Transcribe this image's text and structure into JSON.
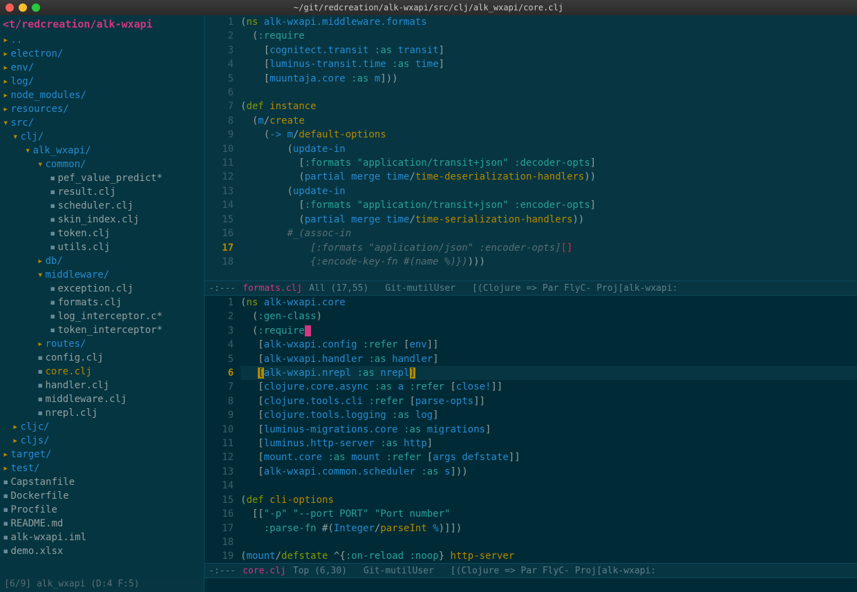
{
  "title": "~/git/redcreation/alk-wxapi/src/clj/alk_wxapi/core.clj",
  "sidebar": {
    "header": "<t/redcreation/alk-wxapi",
    "modeline": "[6/9] alk_wxapi (D:4 F:5)",
    "tree": [
      {
        "type": "folder",
        "name": "..",
        "indent": 0
      },
      {
        "type": "folder",
        "name": "electron/",
        "indent": 0
      },
      {
        "type": "folder",
        "name": "env/",
        "indent": 0
      },
      {
        "type": "folder",
        "name": "log/",
        "indent": 0
      },
      {
        "type": "folder",
        "name": "node_modules/",
        "indent": 0
      },
      {
        "type": "folder",
        "name": "resources/",
        "indent": 0
      },
      {
        "type": "folder",
        "name": "src/",
        "indent": 0,
        "open": true
      },
      {
        "type": "folder",
        "name": "clj/",
        "indent": 1,
        "open": true
      },
      {
        "type": "folder",
        "name": "alk_wxapi/",
        "indent": 2,
        "open": true
      },
      {
        "type": "folder",
        "name": "common/",
        "indent": 3,
        "open": true
      },
      {
        "type": "file",
        "name": "pef_value_predict*",
        "indent": 4
      },
      {
        "type": "file",
        "name": "result.clj",
        "indent": 4
      },
      {
        "type": "file",
        "name": "scheduler.clj",
        "indent": 4
      },
      {
        "type": "file",
        "name": "skin_index.clj",
        "indent": 4
      },
      {
        "type": "file",
        "name": "token.clj",
        "indent": 4
      },
      {
        "type": "file",
        "name": "utils.clj",
        "indent": 4
      },
      {
        "type": "folder",
        "name": "db/",
        "indent": 3
      },
      {
        "type": "folder",
        "name": "middleware/",
        "indent": 3,
        "open": true
      },
      {
        "type": "file",
        "name": "exception.clj",
        "indent": 4
      },
      {
        "type": "file",
        "name": "formats.clj",
        "indent": 4
      },
      {
        "type": "file",
        "name": "log_interceptor.c*",
        "indent": 4
      },
      {
        "type": "file",
        "name": "token_interceptor*",
        "indent": 4
      },
      {
        "type": "folder",
        "name": "routes/",
        "indent": 3
      },
      {
        "type": "file",
        "name": "config.clj",
        "indent": 3
      },
      {
        "type": "file",
        "name": "core.clj",
        "indent": 3,
        "selected": true
      },
      {
        "type": "file",
        "name": "handler.clj",
        "indent": 3
      },
      {
        "type": "file",
        "name": "middleware.clj",
        "indent": 3
      },
      {
        "type": "file",
        "name": "nrepl.clj",
        "indent": 3
      },
      {
        "type": "folder",
        "name": "cljc/",
        "indent": 1
      },
      {
        "type": "folder",
        "name": "cljs/",
        "indent": 1
      },
      {
        "type": "folder",
        "name": "target/",
        "indent": 0
      },
      {
        "type": "folder",
        "name": "test/",
        "indent": 0
      },
      {
        "type": "file",
        "name": "Capstanfile",
        "indent": 0
      },
      {
        "type": "file",
        "name": "Dockerfile",
        "indent": 0
      },
      {
        "type": "file",
        "name": "Procfile",
        "indent": 0
      },
      {
        "type": "file",
        "name": "README.md",
        "indent": 0
      },
      {
        "type": "file",
        "name": "alk-wxapi.iml",
        "indent": 0
      },
      {
        "type": "file",
        "name": "demo.xlsx",
        "indent": 0
      }
    ]
  },
  "topPane": {
    "modeline": {
      "prefix": "-:---",
      "filename": "formats.clj",
      "pos": "All (17,55)",
      "vcs": "Git-mutilUser",
      "modes": "[(Clojure => Par FlyC- Proj[alk-wxapi:"
    },
    "lines": [
      {
        "n": 1,
        "segs": [
          [
            "p",
            "("
          ],
          [
            "kw",
            "ns"
          ],
          [
            "p",
            " "
          ],
          [
            "sym",
            "alk-wxapi.middleware.formats"
          ]
        ]
      },
      {
        "n": 2,
        "segs": [
          [
            "p",
            "  ("
          ],
          [
            "key",
            ":require"
          ]
        ]
      },
      {
        "n": 3,
        "segs": [
          [
            "p",
            "    ["
          ],
          [
            "sym",
            "cognitect.transit"
          ],
          [
            "p",
            " "
          ],
          [
            "key",
            ":as"
          ],
          [
            "p",
            " "
          ],
          [
            "sym",
            "transit"
          ],
          [
            "p",
            "]"
          ]
        ]
      },
      {
        "n": 4,
        "segs": [
          [
            "p",
            "    ["
          ],
          [
            "sym",
            "luminus-transit.time"
          ],
          [
            "p",
            " "
          ],
          [
            "key",
            ":as"
          ],
          [
            "p",
            " "
          ],
          [
            "sym",
            "time"
          ],
          [
            "p",
            "]"
          ]
        ]
      },
      {
        "n": 5,
        "segs": [
          [
            "p",
            "    ["
          ],
          [
            "sym",
            "muuntaja.core"
          ],
          [
            "p",
            " "
          ],
          [
            "key",
            ":as"
          ],
          [
            "p",
            " "
          ],
          [
            "sym",
            "m"
          ],
          [
            "p",
            "]))"
          ]
        ]
      },
      {
        "n": 6,
        "segs": [
          [
            "p",
            ""
          ]
        ]
      },
      {
        "n": 7,
        "segs": [
          [
            "p",
            "("
          ],
          [
            "kw",
            "def"
          ],
          [
            "p",
            " "
          ],
          [
            "yellow",
            "instance"
          ]
        ]
      },
      {
        "n": 8,
        "segs": [
          [
            "p",
            "  ("
          ],
          [
            "sym",
            "m"
          ],
          [
            "p",
            "/"
          ],
          [
            "fnref",
            "create"
          ]
        ]
      },
      {
        "n": 9,
        "segs": [
          [
            "p",
            "    ("
          ],
          [
            "sym",
            "->"
          ],
          [
            "p",
            " "
          ],
          [
            "sym",
            "m"
          ],
          [
            "p",
            "/"
          ],
          [
            "fnref",
            "default-options"
          ]
        ]
      },
      {
        "n": 10,
        "segs": [
          [
            "p",
            "        ("
          ],
          [
            "sym",
            "update-in"
          ]
        ]
      },
      {
        "n": 11,
        "segs": [
          [
            "p",
            "          ["
          ],
          [
            "key",
            ":formats"
          ],
          [
            "p",
            " "
          ],
          [
            "str",
            "\"application/transit+json\""
          ],
          [
            "p",
            " "
          ],
          [
            "key",
            ":decoder-opts"
          ],
          [
            "p",
            "]"
          ]
        ]
      },
      {
        "n": 12,
        "segs": [
          [
            "p",
            "          ("
          ],
          [
            "sym",
            "partial"
          ],
          [
            "p",
            " "
          ],
          [
            "sym",
            "merge"
          ],
          [
            "p",
            " "
          ],
          [
            "sym",
            "time"
          ],
          [
            "p",
            "/"
          ],
          [
            "fnref",
            "time-deserialization-handlers"
          ],
          [
            "p",
            "))"
          ]
        ]
      },
      {
        "n": 13,
        "segs": [
          [
            "p",
            "        ("
          ],
          [
            "sym",
            "update-in"
          ]
        ]
      },
      {
        "n": 14,
        "segs": [
          [
            "p",
            "          ["
          ],
          [
            "key",
            ":formats"
          ],
          [
            "p",
            " "
          ],
          [
            "str",
            "\"application/transit+json\""
          ],
          [
            "p",
            " "
          ],
          [
            "key",
            ":encoder-opts"
          ],
          [
            "p",
            "]"
          ]
        ]
      },
      {
        "n": 15,
        "segs": [
          [
            "p",
            "          ("
          ],
          [
            "sym",
            "partial"
          ],
          [
            "p",
            " "
          ],
          [
            "sym",
            "merge"
          ],
          [
            "p",
            " "
          ],
          [
            "sym",
            "time"
          ],
          [
            "p",
            "/"
          ],
          [
            "fnref",
            "time-serialization-handlers"
          ],
          [
            "p",
            "))"
          ]
        ]
      },
      {
        "n": 16,
        "segs": [
          [
            "p",
            "        "
          ],
          [
            "ital",
            "#_(assoc-in"
          ]
        ]
      },
      {
        "n": 17,
        "current": true,
        "segs": [
          [
            "p",
            "            "
          ],
          [
            "ital",
            "[:formats \"application/json\" :encoder-opts]"
          ],
          [
            "cursor-red-box",
            "[]"
          ]
        ]
      },
      {
        "n": 18,
        "segs": [
          [
            "p",
            "            "
          ],
          [
            "ital",
            "{:encode-key-fn #(name %)})"
          ],
          [
            "p",
            ")))"
          ]
        ]
      }
    ]
  },
  "bottomPane": {
    "modeline": {
      "prefix": "-:---",
      "filename": "core.clj",
      "pos": "Top (6,30)",
      "vcs": "Git-mutilUser",
      "modes": "[(Clojure => Par FlyC- Proj[alk-wxapi:"
    },
    "lines": [
      {
        "n": 1,
        "segs": [
          [
            "p",
            "("
          ],
          [
            "kw",
            "ns"
          ],
          [
            "p",
            " "
          ],
          [
            "sym",
            "alk-wxapi.core"
          ]
        ]
      },
      {
        "n": 2,
        "segs": [
          [
            "p",
            "  ("
          ],
          [
            "key",
            ":gen-class"
          ],
          [
            "p",
            ")"
          ]
        ]
      },
      {
        "n": 3,
        "segs": [
          [
            "p",
            "  ("
          ],
          [
            "key",
            ":require"
          ],
          [
            "cursor",
            ""
          ]
        ]
      },
      {
        "n": 4,
        "segs": [
          [
            "p",
            "   ["
          ],
          [
            "sym",
            "alk-wxapi.config"
          ],
          [
            "p",
            " "
          ],
          [
            "key",
            ":refer"
          ],
          [
            "p",
            " ["
          ],
          [
            "sym",
            "env"
          ],
          [
            "p",
            "]]"
          ]
        ]
      },
      {
        "n": 5,
        "segs": [
          [
            "p",
            "   ["
          ],
          [
            "sym",
            "alk-wxapi.handler"
          ],
          [
            "p",
            " "
          ],
          [
            "key",
            ":as"
          ],
          [
            "p",
            " "
          ],
          [
            "sym",
            "handler"
          ],
          [
            "p",
            "]"
          ]
        ]
      },
      {
        "n": 6,
        "current": true,
        "segs": [
          [
            "p",
            "   "
          ],
          [
            "hl-bracket",
            "["
          ],
          [
            "sym",
            "alk-wxapi.nrepl"
          ],
          [
            "p",
            " "
          ],
          [
            "key",
            ":as"
          ],
          [
            "p",
            " "
          ],
          [
            "sym",
            "nrepl"
          ],
          [
            "hl-bracket",
            "]"
          ]
        ]
      },
      {
        "n": 7,
        "segs": [
          [
            "p",
            "   ["
          ],
          [
            "sym",
            "clojure.core.async"
          ],
          [
            "p",
            " "
          ],
          [
            "key",
            ":as"
          ],
          [
            "p",
            " "
          ],
          [
            "sym",
            "a"
          ],
          [
            "p",
            " "
          ],
          [
            "key",
            ":refer"
          ],
          [
            "p",
            " ["
          ],
          [
            "sym",
            "close!"
          ],
          [
            "p",
            "]]"
          ]
        ]
      },
      {
        "n": 8,
        "segs": [
          [
            "p",
            "   ["
          ],
          [
            "sym",
            "clojure.tools.cli"
          ],
          [
            "p",
            " "
          ],
          [
            "key",
            ":refer"
          ],
          [
            "p",
            " ["
          ],
          [
            "sym",
            "parse-opts"
          ],
          [
            "p",
            "]]"
          ]
        ]
      },
      {
        "n": 9,
        "segs": [
          [
            "p",
            "   ["
          ],
          [
            "sym",
            "clojure.tools.logging"
          ],
          [
            "p",
            " "
          ],
          [
            "key",
            ":as"
          ],
          [
            "p",
            " "
          ],
          [
            "sym",
            "log"
          ],
          [
            "p",
            "]"
          ]
        ]
      },
      {
        "n": 10,
        "segs": [
          [
            "p",
            "   ["
          ],
          [
            "sym",
            "luminus-migrations.core"
          ],
          [
            "p",
            " "
          ],
          [
            "key",
            ":as"
          ],
          [
            "p",
            " "
          ],
          [
            "sym",
            "migrations"
          ],
          [
            "p",
            "]"
          ]
        ]
      },
      {
        "n": 11,
        "segs": [
          [
            "p",
            "   ["
          ],
          [
            "sym",
            "luminus.http-server"
          ],
          [
            "p",
            " "
          ],
          [
            "key",
            ":as"
          ],
          [
            "p",
            " "
          ],
          [
            "sym",
            "http"
          ],
          [
            "p",
            "]"
          ]
        ]
      },
      {
        "n": 12,
        "segs": [
          [
            "p",
            "   ["
          ],
          [
            "sym",
            "mount.core"
          ],
          [
            "p",
            " "
          ],
          [
            "key",
            ":as"
          ],
          [
            "p",
            " "
          ],
          [
            "sym",
            "mount"
          ],
          [
            "p",
            " "
          ],
          [
            "key",
            ":refer"
          ],
          [
            "p",
            " ["
          ],
          [
            "sym",
            "args"
          ],
          [
            "p",
            " "
          ],
          [
            "sym",
            "defstate"
          ],
          [
            "p",
            "]]"
          ]
        ]
      },
      {
        "n": 13,
        "segs": [
          [
            "p",
            "   ["
          ],
          [
            "sym",
            "alk-wxapi.common.scheduler"
          ],
          [
            "p",
            " "
          ],
          [
            "key",
            ":as"
          ],
          [
            "p",
            " "
          ],
          [
            "sym",
            "s"
          ],
          [
            "p",
            "]))"
          ]
        ]
      },
      {
        "n": 14,
        "segs": [
          [
            "p",
            ""
          ]
        ]
      },
      {
        "n": 15,
        "segs": [
          [
            "p",
            "("
          ],
          [
            "kw",
            "def"
          ],
          [
            "p",
            " "
          ],
          [
            "yellow",
            "cli-options"
          ]
        ]
      },
      {
        "n": 16,
        "segs": [
          [
            "p",
            "  [["
          ],
          [
            "str",
            "\"-p\""
          ],
          [
            "p",
            " "
          ],
          [
            "str",
            "\"--port PORT\""
          ],
          [
            "p",
            " "
          ],
          [
            "str",
            "\"Port number\""
          ]
        ]
      },
      {
        "n": 17,
        "segs": [
          [
            "p",
            "    "
          ],
          [
            "key",
            ":parse-fn"
          ],
          [
            "p",
            " #("
          ],
          [
            "sym",
            "Integer"
          ],
          [
            "p",
            "/"
          ],
          [
            "fnref",
            "parseInt"
          ],
          [
            "p",
            " "
          ],
          [
            "sym",
            "%"
          ],
          [
            "p",
            ")]])"
          ]
        ]
      },
      {
        "n": 18,
        "segs": [
          [
            "p",
            ""
          ]
        ]
      },
      {
        "n": 19,
        "segs": [
          [
            "p",
            "("
          ],
          [
            "sym",
            "mount"
          ],
          [
            "p",
            "/"
          ],
          [
            "kw",
            "defstate"
          ],
          [
            "p",
            " ^{"
          ],
          [
            "key",
            ":on-reload"
          ],
          [
            "p",
            " "
          ],
          [
            "key",
            ":noop"
          ],
          [
            "p",
            "} "
          ],
          [
            "yellow",
            "http-server"
          ]
        ]
      }
    ]
  }
}
